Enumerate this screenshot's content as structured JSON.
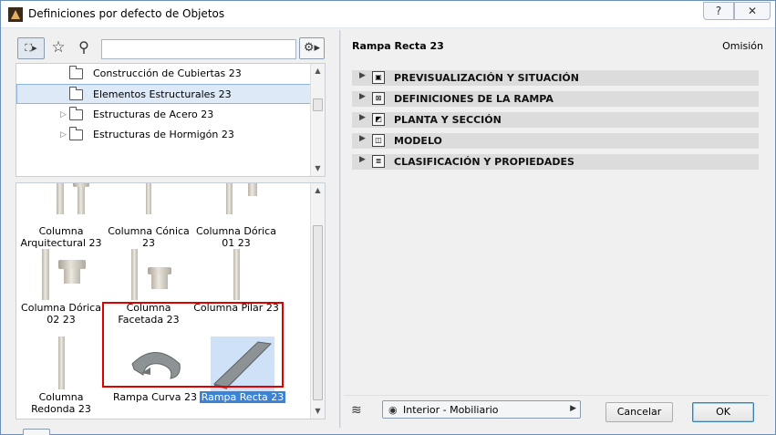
{
  "window": {
    "title": "Definiciones por defecto de Objetos",
    "help_label": "?",
    "close_label": "✕"
  },
  "toolbar": {
    "library_icon": "library-browser-icon",
    "star_icon": "star-icon",
    "search_icon": "search-icon",
    "search_placeholder": "",
    "settings_icon": "gear-icon"
  },
  "tree": {
    "items": [
      {
        "label": "Construcción de Cubiertas 23",
        "selected": false
      },
      {
        "label": "Elementos Estructurales 23",
        "selected": true
      },
      {
        "label": "Estructuras de Acero 23",
        "selected": false
      },
      {
        "label": "Estructuras de Hormigón 23",
        "selected": false
      }
    ]
  },
  "grid": {
    "items": [
      {
        "line1": "Columna",
        "line2": "Arquitectural 23"
      },
      {
        "line1": "Columna Cónica",
        "line2": "23"
      },
      {
        "line1": "Columna Dórica",
        "line2": "01 23"
      },
      {
        "line1": "Columna Dórica",
        "line2": "02 23"
      },
      {
        "line1": "Columna",
        "line2": "Facetada 23"
      },
      {
        "line1": "Columna Pilar 23",
        "line2": ""
      },
      {
        "line1": "Columna",
        "line2": "Redonda 23"
      },
      {
        "line1": "Rampa Curva 23",
        "line2": ""
      },
      {
        "line1": "Rampa Recta 23",
        "line2": "",
        "selected": true
      }
    ]
  },
  "details": {
    "title": "Rampa Recta 23",
    "default_label": "Omisión",
    "sections": [
      {
        "label": "PREVISUALIZACIÓN Y SITUACIÓN",
        "icon": "preview-icon"
      },
      {
        "label": "DEFINICIONES DE LA RAMPA",
        "icon": "ramp-settings-icon"
      },
      {
        "label": "PLANTA Y SECCIÓN",
        "icon": "floor-plan-icon"
      },
      {
        "label": "MODELO",
        "icon": "model-cube-icon"
      },
      {
        "label": "CLASIFICACIÓN Y PROPIEDADES",
        "icon": "classification-icon"
      }
    ]
  },
  "footer": {
    "layer_value": "Interior - Mobiliario",
    "cancel_label": "Cancelar",
    "ok_label": "OK"
  },
  "colors": {
    "selection": "#3c83d8",
    "highlight_border": "#e00000",
    "section_bg": "#dcdcdc"
  }
}
